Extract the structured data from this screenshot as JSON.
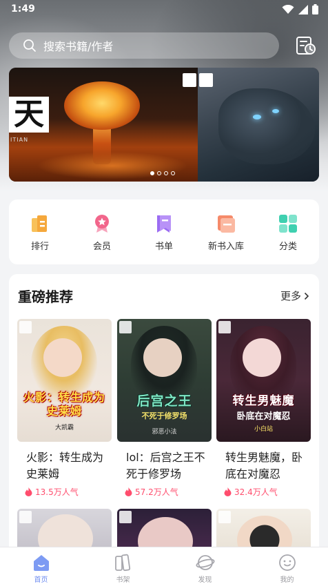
{
  "status_bar": {
    "time": "1:49"
  },
  "search": {
    "placeholder": "搜索书籍/作者"
  },
  "banner": {
    "left_title": "天",
    "left_subtitle": "ITIAN",
    "page_count": 4,
    "active_page": 1
  },
  "quick_menu": [
    {
      "label": "排行",
      "icon": "ranking-icon",
      "color": "#f5a83c"
    },
    {
      "label": "会员",
      "icon": "member-icon",
      "color": "#f2668b"
    },
    {
      "label": "书单",
      "icon": "booklist-icon",
      "color": "#9b6cf2"
    },
    {
      "label": "新书入库",
      "icon": "new-books-icon",
      "color": "#f58a6a"
    },
    {
      "label": "分类",
      "icon": "category-icon",
      "color": "#3fd0b0"
    }
  ],
  "recommend": {
    "title": "重磅推荐",
    "more_label": "更多",
    "books": [
      {
        "name": "火影：转生成为史莱姆",
        "heat": "13.5万人气",
        "cover_title": "火影：转生成为史莱姆",
        "cover_author": "大凯霸"
      },
      {
        "name": "lol：后宫之王不死于修罗场",
        "heat": "57.2万人气",
        "cover_title": "后宫之王",
        "cover_subtitle": "不死于修罗场",
        "cover_author": "邪恶小法"
      },
      {
        "name": "转生男魅魔，卧底在对魔忍",
        "heat": "32.4万人气",
        "cover_title": "转生男魅魔",
        "cover_subtitle": "卧底在对魔忍",
        "cover_author": "小白站"
      }
    ]
  },
  "bottom_nav": [
    {
      "label": "首页",
      "icon": "home-icon",
      "active": true
    },
    {
      "label": "书架",
      "icon": "bookshelf-icon",
      "active": false
    },
    {
      "label": "发现",
      "icon": "discover-icon",
      "active": false
    },
    {
      "label": "我的",
      "icon": "profile-icon",
      "active": false
    }
  ],
  "colors": {
    "accent": "#6f8ef0",
    "heat": "#ff4d6d"
  }
}
